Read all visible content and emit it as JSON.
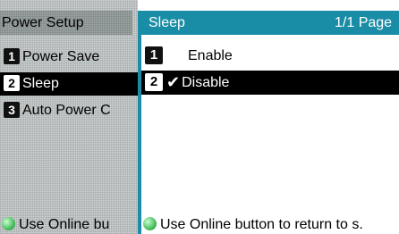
{
  "left_panel": {
    "title": "Power Setup",
    "items": [
      {
        "num": "1",
        "label": "Power Save"
      },
      {
        "num": "2",
        "label": "Sleep"
      },
      {
        "num": "3",
        "label": "Auto Power C"
      }
    ],
    "hint": "Use Online bu"
  },
  "right_panel": {
    "title": "Sleep",
    "page": "1/1 Page",
    "items": [
      {
        "num": "1",
        "label": "Enable"
      },
      {
        "num": "2",
        "label": "Disable"
      }
    ],
    "hint": "Use Online button to return to s."
  },
  "colors": {
    "accent": "#1a8da6",
    "selected_bg": "#000000"
  },
  "icons": {
    "check": "checkmark-icon",
    "online": "online-button-icon"
  }
}
